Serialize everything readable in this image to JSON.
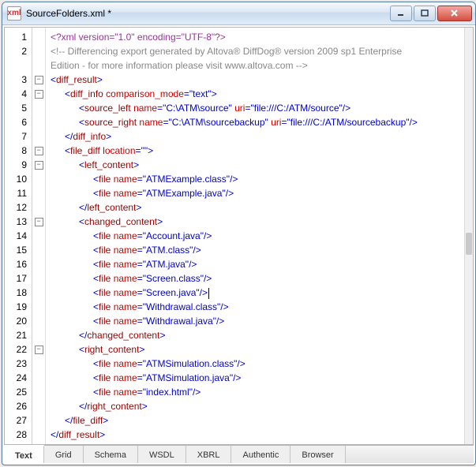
{
  "window": {
    "title": "SourceFolders.xml *",
    "icon_label": "xml"
  },
  "tabs": {
    "items": [
      "Text",
      "Grid",
      "Schema",
      "WSDL",
      "XBRL",
      "Authentic",
      "Browser"
    ],
    "active_index": 0
  },
  "code": {
    "line_count": 28,
    "cursor_line": 18,
    "fold_minus_lines": [
      3,
      4,
      8,
      9,
      13,
      22
    ],
    "lines": [
      {
        "n": 1,
        "indent": 0,
        "type": "pi",
        "text": "<?xml version=\"1.0\" encoding=\"UTF-8\"?>"
      },
      {
        "n": 2,
        "indent": 0,
        "type": "cmt",
        "text": "<!-- Differencing export generated by Altova® DiffDog® version 2009 sp1 Enterprise"
      },
      {
        "n": null,
        "indent": 0,
        "type": "cmt",
        "text": "Edition - for more information please visit www.altova.com -->"
      },
      {
        "n": 3,
        "indent": 0,
        "type": "open",
        "tag": "diff_result"
      },
      {
        "n": 4,
        "indent": 1,
        "type": "open",
        "tag": "diff_info",
        "attrs": [
          [
            "comparison_mode",
            "text"
          ]
        ]
      },
      {
        "n": 5,
        "indent": 2,
        "type": "selfclose",
        "tag": "source_left",
        "attrs": [
          [
            "name",
            "C:\\ATM\\source"
          ],
          [
            "uri",
            "file:///C:/ATM/source"
          ]
        ]
      },
      {
        "n": 6,
        "indent": 2,
        "type": "selfclose",
        "tag": "source_right",
        "attrs": [
          [
            "name",
            "C:\\ATM\\sourcebackup"
          ],
          [
            "uri",
            "file:///C:/ATM/sourcebackup"
          ]
        ]
      },
      {
        "n": 7,
        "indent": 1,
        "type": "close",
        "tag": "diff_info"
      },
      {
        "n": 8,
        "indent": 1,
        "type": "open",
        "tag": "file_diff",
        "attrs": [
          [
            "location",
            ""
          ]
        ]
      },
      {
        "n": 9,
        "indent": 2,
        "type": "open",
        "tag": "left_content"
      },
      {
        "n": 10,
        "indent": 3,
        "type": "selfclose",
        "tag": "file",
        "attrs": [
          [
            "name",
            "ATMExample.class"
          ]
        ]
      },
      {
        "n": 11,
        "indent": 3,
        "type": "selfclose",
        "tag": "file",
        "attrs": [
          [
            "name",
            "ATMExample.java"
          ]
        ]
      },
      {
        "n": 12,
        "indent": 2,
        "type": "close",
        "tag": "left_content"
      },
      {
        "n": 13,
        "indent": 2,
        "type": "open",
        "tag": "changed_content"
      },
      {
        "n": 14,
        "indent": 3,
        "type": "selfclose",
        "tag": "file",
        "attrs": [
          [
            "name",
            "Account.java"
          ]
        ]
      },
      {
        "n": 15,
        "indent": 3,
        "type": "selfclose",
        "tag": "file",
        "attrs": [
          [
            "name",
            "ATM.class"
          ]
        ]
      },
      {
        "n": 16,
        "indent": 3,
        "type": "selfclose",
        "tag": "file",
        "attrs": [
          [
            "name",
            "ATM.java"
          ]
        ]
      },
      {
        "n": 17,
        "indent": 3,
        "type": "selfclose",
        "tag": "file",
        "attrs": [
          [
            "name",
            "Screen.class"
          ]
        ]
      },
      {
        "n": 18,
        "indent": 3,
        "type": "selfclose",
        "tag": "file",
        "attrs": [
          [
            "name",
            "Screen.java"
          ]
        ],
        "cursor_after": true
      },
      {
        "n": 19,
        "indent": 3,
        "type": "selfclose",
        "tag": "file",
        "attrs": [
          [
            "name",
            "Withdrawal.class"
          ]
        ]
      },
      {
        "n": 20,
        "indent": 3,
        "type": "selfclose",
        "tag": "file",
        "attrs": [
          [
            "name",
            "Withdrawal.java"
          ]
        ]
      },
      {
        "n": 21,
        "indent": 2,
        "type": "close",
        "tag": "changed_content"
      },
      {
        "n": 22,
        "indent": 2,
        "type": "open",
        "tag": "right_content"
      },
      {
        "n": 23,
        "indent": 3,
        "type": "selfclose",
        "tag": "file",
        "attrs": [
          [
            "name",
            "ATMSimulation.class"
          ]
        ]
      },
      {
        "n": 24,
        "indent": 3,
        "type": "selfclose",
        "tag": "file",
        "attrs": [
          [
            "name",
            "ATMSimulation.java"
          ]
        ]
      },
      {
        "n": 25,
        "indent": 3,
        "type": "selfclose",
        "tag": "file",
        "attrs": [
          [
            "name",
            "index.html"
          ]
        ]
      },
      {
        "n": 26,
        "indent": 2,
        "type": "close",
        "tag": "right_content"
      },
      {
        "n": 27,
        "indent": 1,
        "type": "close",
        "tag": "file_diff"
      },
      {
        "n": 28,
        "indent": 0,
        "type": "close",
        "tag": "diff_result"
      }
    ]
  }
}
